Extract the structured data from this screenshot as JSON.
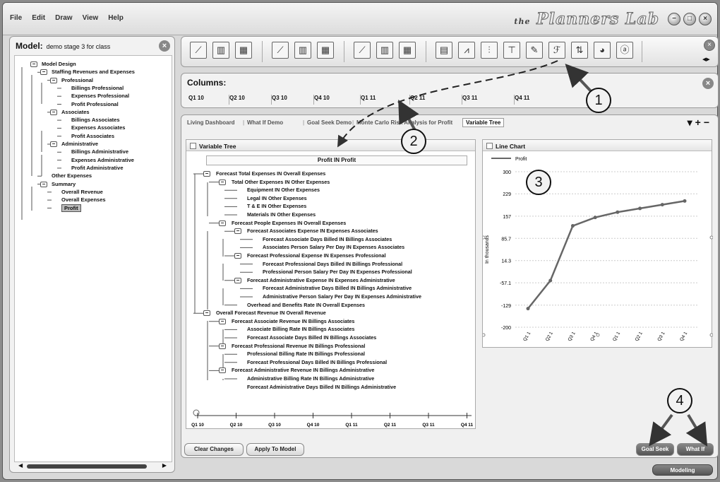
{
  "menu": [
    "File",
    "Edit",
    "Draw",
    "View",
    "Help"
  ],
  "logo": {
    "prefix": "the",
    "name": "Planners Lab"
  },
  "window_buttons": [
    "−",
    "□",
    "×"
  ],
  "model": {
    "label": "Model:",
    "name": "demo stage 3 for class",
    "tree": [
      {
        "label": "Model Design",
        "box": "−"
      },
      {
        "label": "Staffing Revenues and Expenses",
        "box": "−"
      },
      {
        "label": "Professional",
        "box": "−"
      },
      {
        "label": "Billings Professional"
      },
      {
        "label": "Expenses Professional"
      },
      {
        "label": "Profit Professional"
      },
      {
        "label": "Associates",
        "box": "−"
      },
      {
        "label": "Billings Associates"
      },
      {
        "label": "Expenses Associates"
      },
      {
        "label": "Profit Associates"
      },
      {
        "label": "Administrative",
        "box": "−"
      },
      {
        "label": "Billings Administrative"
      },
      {
        "label": "Expenses Administrative"
      },
      {
        "label": "Profit  Administrative"
      },
      {
        "label": "Other Expenses"
      },
      {
        "label": "Summary",
        "box": "−"
      },
      {
        "label": "Overall Revenue"
      },
      {
        "label": "Overall Expenses"
      },
      {
        "label": "Profit",
        "selected": true
      }
    ]
  },
  "columns": {
    "title": "Columns:",
    "quarters": [
      "Q1 10",
      "Q2 10",
      "Q3 10",
      "Q4 10",
      "Q1 11",
      "Q2 11",
      "Q3 11",
      "Q4 11"
    ]
  },
  "tabs": [
    "Living Dashboard",
    "What If Demo",
    "Goal Seek Demo",
    "Monte Carlo Risk Analysis for Profit",
    "Variable Tree"
  ],
  "tab_controls": [
    "▾",
    "+",
    "−"
  ],
  "variable_tree": {
    "title": "Variable Tree",
    "root": "Profit IN Profit",
    "nodes": [
      {
        "label": "Forecast Total Expenses IN Overall Expenses",
        "box": "−"
      },
      {
        "label": "Total Other Expenses IN Other Expenses",
        "box": "−"
      },
      {
        "label": "Equipment IN Other Expenses"
      },
      {
        "label": "Legal IN Other Expenses"
      },
      {
        "label": "T & E IN Other Expenses"
      },
      {
        "label": "Materials IN Other Expenses"
      },
      {
        "label": "Forecast People Expenses IN Overall Expenses",
        "box": "−"
      },
      {
        "label": "Forecast Associates Expense IN Expenses Associates",
        "box": "−"
      },
      {
        "label": "Forecast Associate Days Billed IN Billings Associates"
      },
      {
        "label": "Associates Person Salary Per Day IN Expenses Associates"
      },
      {
        "label": "Forecast Professional Expense IN Expenses Professional",
        "box": "−"
      },
      {
        "label": "Forecast Professional Days Billed IN Billings Professional"
      },
      {
        "label": "Professional Person Salary Per Day IN Expenses Professional"
      },
      {
        "label": "Forecast Administrative Expense IN Expenses Administrative",
        "box": "−"
      },
      {
        "label": "Forecast Administrative Days Billed IN Billings Administrative"
      },
      {
        "label": "Administrative Person Salary Per Day IN Expenses Administrative"
      },
      {
        "label": "Overhead and Benefits Rate IN Overall Expenses"
      },
      {
        "label": "Overall Forecast Revenue IN Overall Revenue",
        "box": "−"
      },
      {
        "label": "Forecast Associate Revenue IN Billings Associates",
        "box": "−"
      },
      {
        "label": "Associate Billing Rate IN Billings Associates"
      },
      {
        "label": "Forecast Associate Days Billed IN Billings Associates"
      },
      {
        "label": "Forecast Professional Revenue IN Billings Professional",
        "box": "−"
      },
      {
        "label": "Professional Billing Rate IN Billings Professional"
      },
      {
        "label": "Forecast Professional Days Billed IN Billings Professional"
      },
      {
        "label": "Forecast Administrative Revenue IN Billings Administrative",
        "box": "−"
      },
      {
        "label": "Administrative Billing Rate IN Billings Administrative"
      },
      {
        "label": "Forecast Administrative Days Billed IN Billings Administrative"
      }
    ],
    "timeline": [
      "Q1 10",
      "Q2 10",
      "Q3 10",
      "Q4 10",
      "Q1 11",
      "Q2 11",
      "Q3 11",
      "Q4 11"
    ]
  },
  "chart_data": {
    "type": "line",
    "title": "Line Chart",
    "ylabel": "In thousands",
    "xlabel": "",
    "categories": [
      "Q1 10",
      "Q2 10",
      "Q3 10",
      "Q4 10",
      "Q1 11",
      "Q2 11",
      "Q3 11",
      "Q4 11"
    ],
    "x_tick_labels": [
      "Q1 1",
      "Q2 1",
      "Q3 1",
      "Q4 1",
      "Q1 1",
      "Q2 1",
      "Q3 1",
      "Q4 1"
    ],
    "series": [
      {
        "name": "Profit",
        "values": [
          -140,
          -50,
          126,
          153,
          170,
          182,
          194,
          206
        ]
      }
    ],
    "y_ticks": [
      "300",
      "229",
      "157",
      "85.7",
      "14.3",
      "-57.1",
      "-129",
      "-200"
    ],
    "ylim": [
      -200,
      300
    ],
    "grid": true,
    "legend": "top-left",
    "color": "#666666"
  },
  "buttons": {
    "clear": "Clear Changes",
    "apply": "Apply To Model",
    "goal_seek": "Goal Seek",
    "what_if": "What If",
    "modeling": "Modeling"
  },
  "callouts": [
    "1",
    "2",
    "3",
    "4"
  ]
}
